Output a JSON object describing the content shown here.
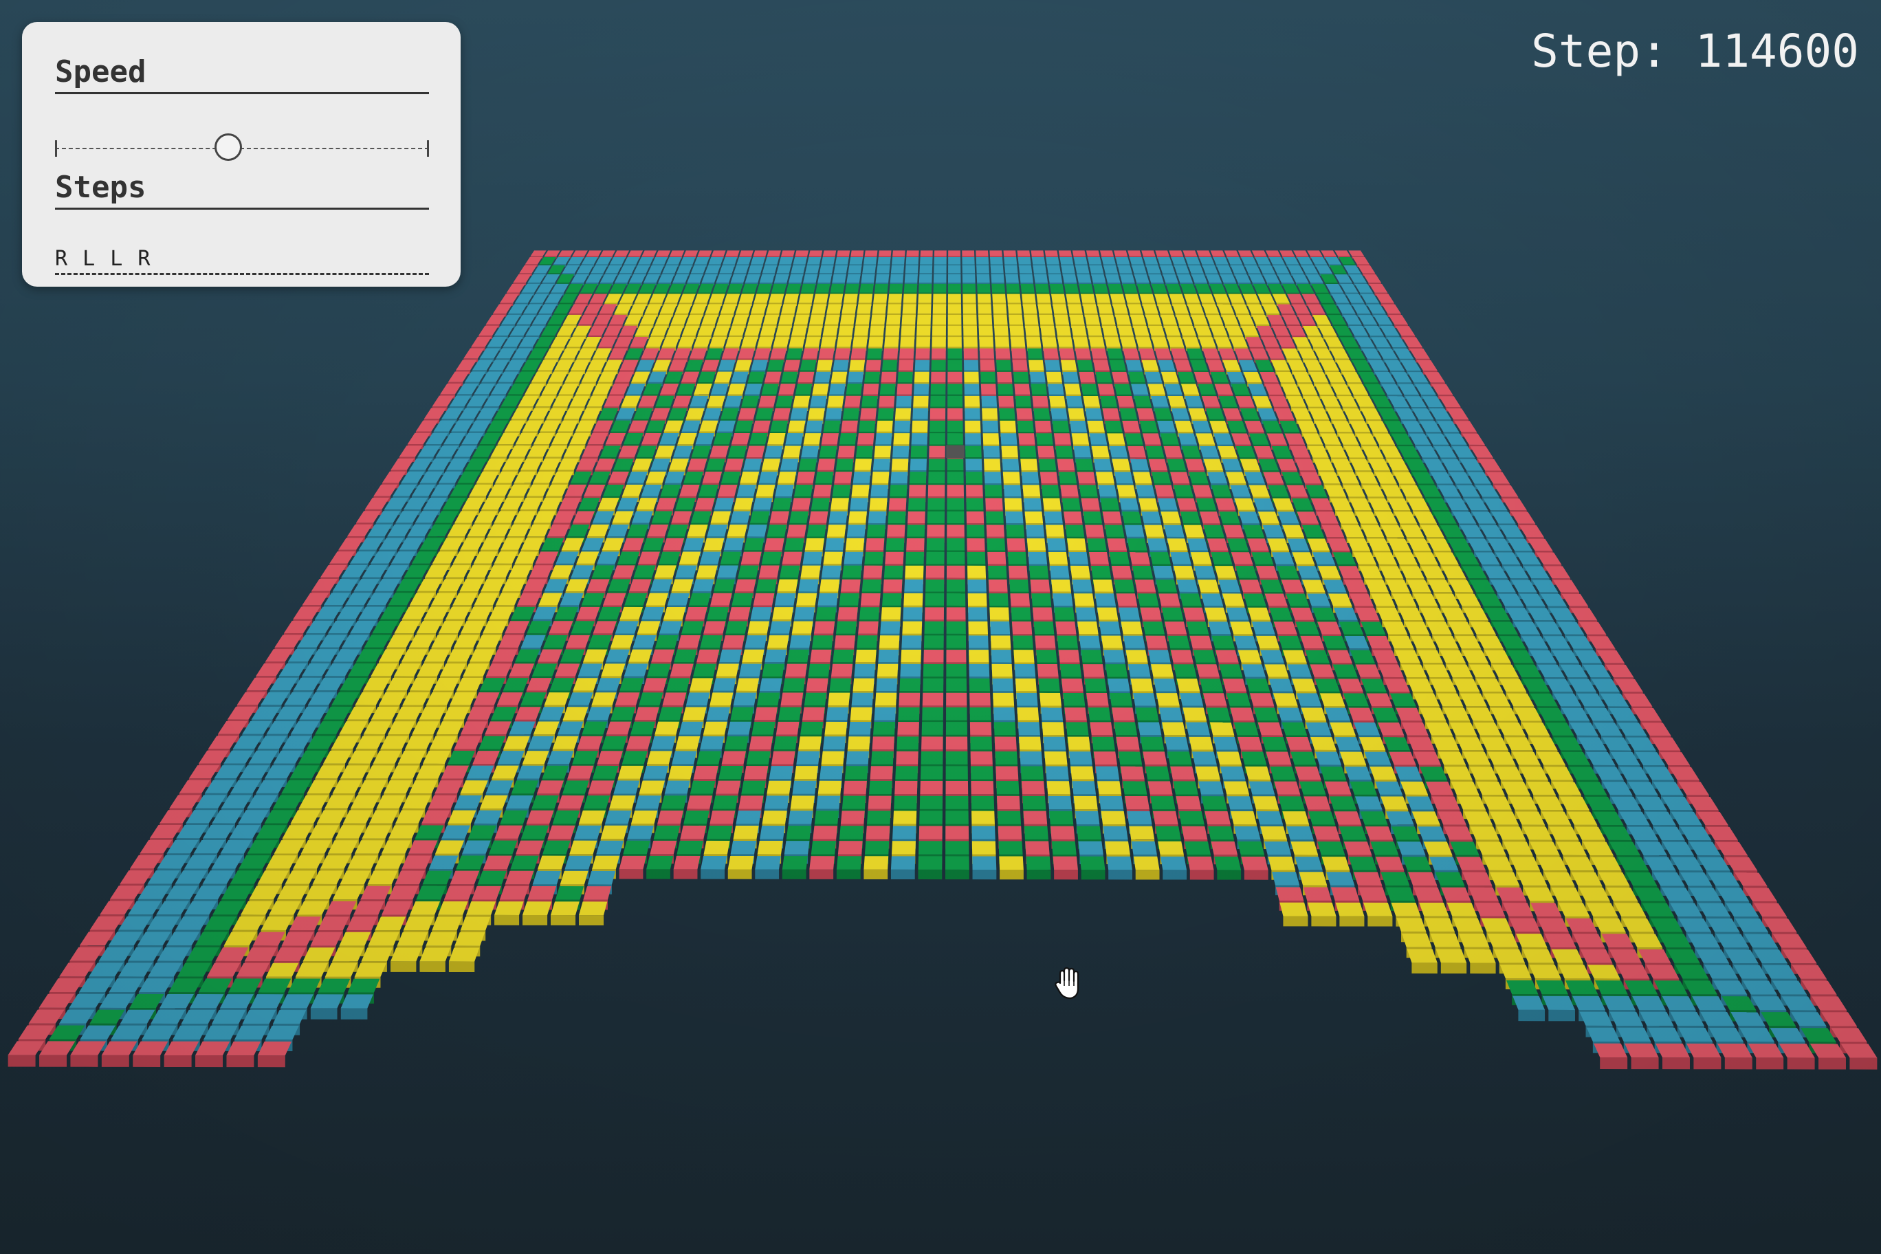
{
  "controls": {
    "speed_label": "Speed",
    "speed_level": 0.46,
    "steps_label": "Steps",
    "steps_value": "R L L R"
  },
  "status": {
    "step_text": "Step: 114600"
  },
  "board": {
    "description_colors": {
      "R": "#e85a6a",
      "L1": "#3aa0c0",
      "L2": "#10a04a",
      "R2": "#f2e02a",
      "ant": "#555555"
    }
  },
  "cursor": {
    "icon": "grab-hand-icon"
  }
}
